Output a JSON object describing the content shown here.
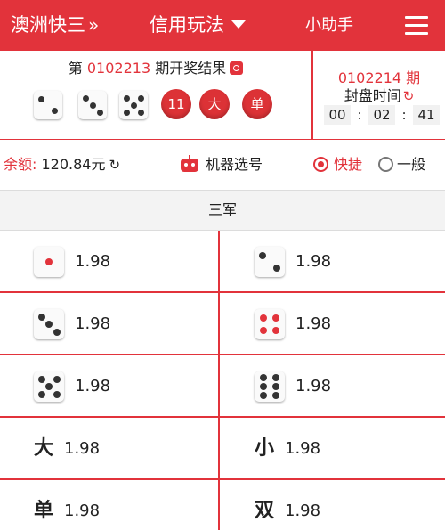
{
  "header": {
    "title": "澳洲快三",
    "title_chevron": "»",
    "mode": "信用玩法",
    "helper": "小助手"
  },
  "last_draw": {
    "prefix": "第",
    "issue": "0102213",
    "suffix": "期开奖结果",
    "dice": [
      2,
      3,
      5
    ],
    "sum": "11",
    "size": "大",
    "parity": "单"
  },
  "next_draw": {
    "issue": "0102214 期",
    "close_label": "封盘时间",
    "countdown": [
      "00",
      "02",
      "41"
    ],
    "separator": ":"
  },
  "account": {
    "balance_label": "余额:",
    "balance_value": "120.84元"
  },
  "machine_pick_label": "机器选号",
  "bet_mode": {
    "options": [
      "快捷",
      "一般"
    ],
    "selected": "快捷"
  },
  "section_title": "三军",
  "bets": [
    {
      "type": "die",
      "face": 1,
      "odds": "1.98"
    },
    {
      "type": "die",
      "face": 2,
      "odds": "1.98"
    },
    {
      "type": "die",
      "face": 3,
      "odds": "1.98"
    },
    {
      "type": "die",
      "face": 4,
      "odds": "1.98"
    },
    {
      "type": "die",
      "face": 5,
      "odds": "1.98"
    },
    {
      "type": "die",
      "face": 6,
      "odds": "1.98"
    },
    {
      "type": "text",
      "label": "大",
      "odds": "1.98"
    },
    {
      "type": "text",
      "label": "小",
      "odds": "1.98"
    },
    {
      "type": "text",
      "label": "单",
      "odds": "1.98"
    },
    {
      "type": "text",
      "label": "双",
      "odds": "1.98"
    }
  ],
  "colors": {
    "brand_red": "#e2333b",
    "pip_dark": "#333333",
    "pip_red": "#e2333b",
    "section_bg": "#f3f3f3"
  }
}
